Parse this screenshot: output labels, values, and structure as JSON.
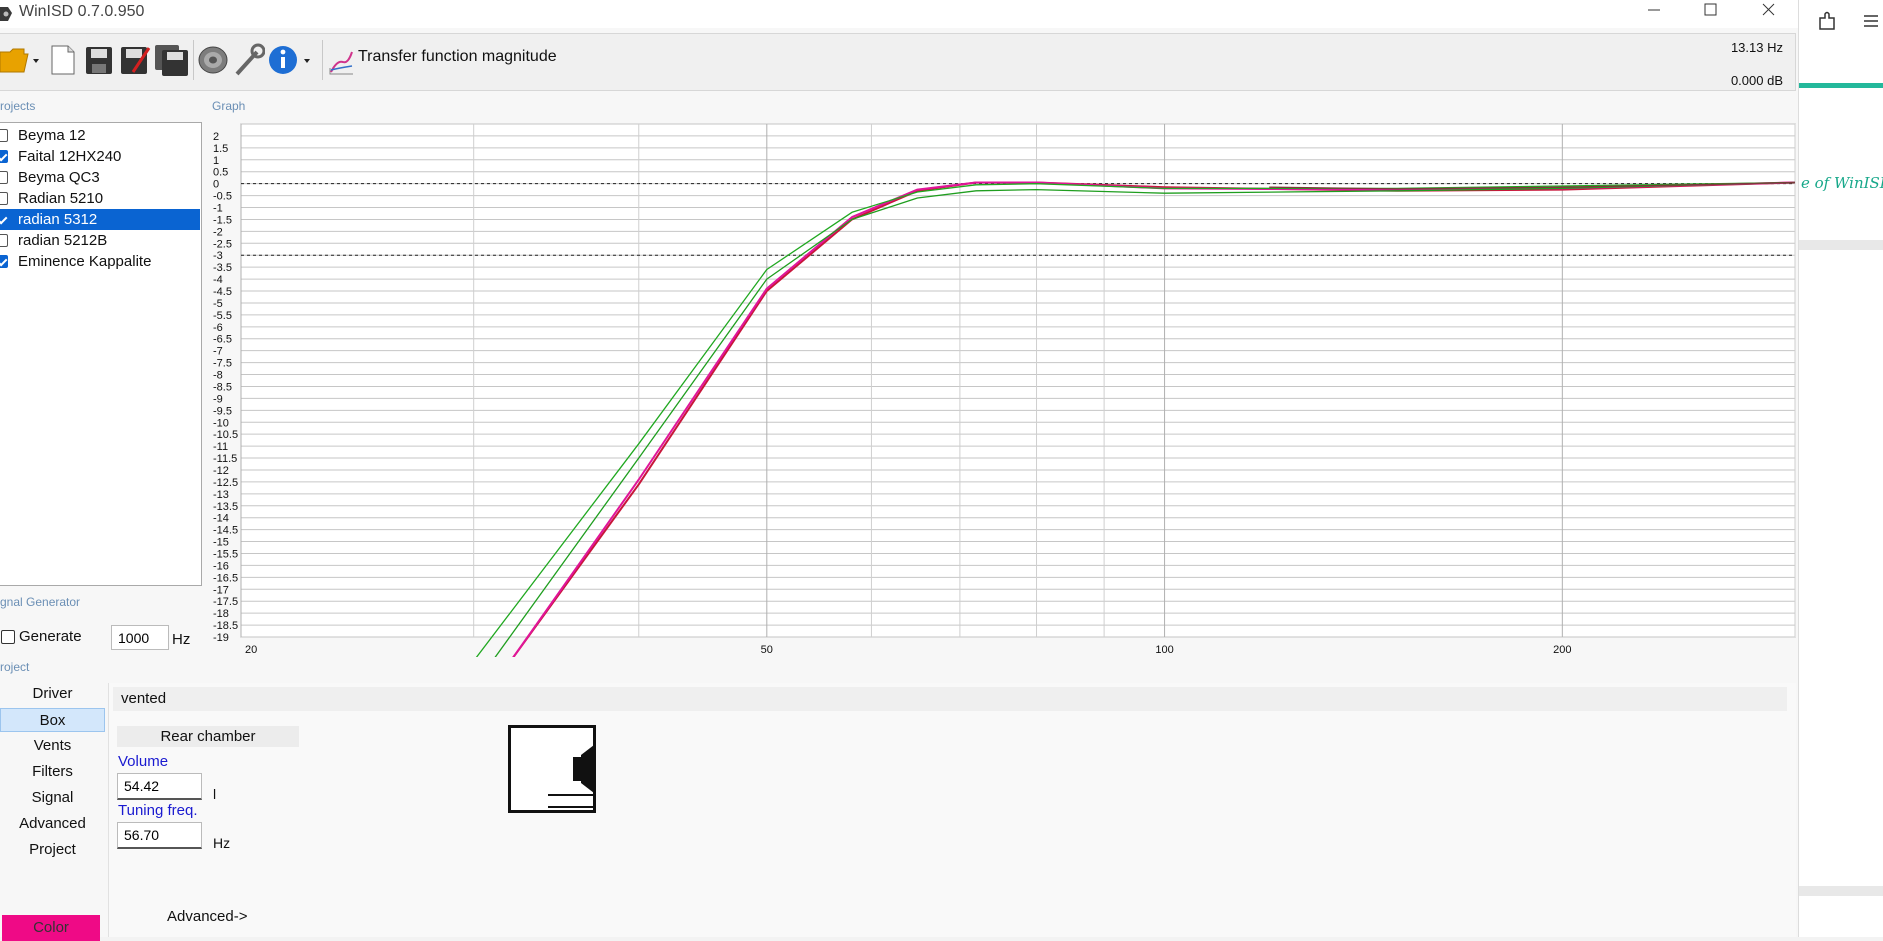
{
  "window": {
    "title": "WinISD 0.7.0.950"
  },
  "toolbar": {
    "graph_selector_label": "Transfer function magnitude"
  },
  "readout": {
    "frequency": "13.13 Hz",
    "level": "0.000 dB"
  },
  "sections": {
    "projects": "rojects",
    "graph": "Graph",
    "signal_generator": "gnal Generator",
    "project": "roject"
  },
  "projects": [
    {
      "name": "Beyma 12",
      "checked": false,
      "selected": false
    },
    {
      "name": "Faital 12HX240",
      "checked": true,
      "selected": false
    },
    {
      "name": "Beyma QC3",
      "checked": false,
      "selected": false
    },
    {
      "name": "Radian 5210",
      "checked": false,
      "selected": false
    },
    {
      "name": "radian 5312",
      "checked": true,
      "selected": true
    },
    {
      "name": "radian 5212B",
      "checked": false,
      "selected": false
    },
    {
      "name": "Eminence Kappalite",
      "checked": true,
      "selected": false
    }
  ],
  "signal_generator": {
    "generate_label": "Generate",
    "frequency": "1000",
    "unit": "Hz"
  },
  "nav": {
    "items": [
      "Driver",
      "Box",
      "Vents",
      "Filters",
      "Signal",
      "Advanced",
      "Project"
    ],
    "selected": "Box",
    "color_button": "Color"
  },
  "box_panel": {
    "box_type": "vented",
    "rear_chamber_label": "Rear chamber",
    "volume_label": "Volume",
    "volume_value": "54.42",
    "volume_unit": "l",
    "tuning_label": "Tuning freq.",
    "tuning_value": "56.70",
    "tuning_unit": "Hz",
    "advanced_link": "Advanced->"
  },
  "side_panel": {
    "brand_text": "e of WinISD"
  },
  "colors": {
    "selection": "#0a64d2",
    "section_label": "#6b8fb5",
    "field_label": "#1a1ad0",
    "color_swatch": "#ef0a86",
    "brand_teal": "#17a88a"
  },
  "chart_data": {
    "type": "line",
    "title": "",
    "xlabel": "",
    "ylabel": "",
    "x_scale": "log",
    "xlim": [
      20,
      300
    ],
    "ylim": [
      -19,
      2
    ],
    "x_ticks": [
      20,
      50,
      100,
      200
    ],
    "y_ticks": [
      "2",
      "1.5",
      "1",
      "0.5",
      "0",
      "-0.5",
      "-1",
      "-1.5",
      "-2",
      "-2.5",
      "-3",
      "-3.5",
      "-4",
      "-4.5",
      "-5",
      "-5.5",
      "-6",
      "-6.5",
      "-7",
      "-7.5",
      "-8",
      "-8.5",
      "-9",
      "-9.5",
      "-10",
      "-10.5",
      "-11",
      "-11.5",
      "-12",
      "-12.5",
      "-13",
      "-13.5",
      "-14",
      "-14.5",
      "-15",
      "-15.5",
      "-16",
      "-16.5",
      "-17",
      "-17.5",
      "-18",
      "-18.5",
      "-19"
    ],
    "reference_lines": [
      0,
      -3
    ],
    "grid": true,
    "series": [
      {
        "color": "#c8163a",
        "x": [
          32,
          40,
          50,
          58,
          65,
          72,
          80,
          100,
          150,
          200,
          300
        ],
        "y": [
          -20,
          -12.6,
          -4.5,
          -1.5,
          -0.3,
          0.05,
          0.05,
          -0.15,
          -0.3,
          -0.25,
          0.05
        ]
      },
      {
        "color": "#e0159a",
        "x": [
          32,
          40,
          50,
          58,
          65,
          72,
          80,
          100,
          150,
          200,
          300
        ],
        "y": [
          -20,
          -12.4,
          -4.4,
          -1.4,
          -0.25,
          0.05,
          0.05,
          -0.2,
          -0.25,
          -0.2,
          0.05
        ]
      },
      {
        "color": "#1f9e1f",
        "x": [
          31,
          40,
          50,
          58,
          65,
          72,
          80,
          100,
          150,
          200,
          300
        ],
        "y": [
          -20,
          -11.5,
          -4.0,
          -1.5,
          -0.6,
          -0.3,
          -0.25,
          -0.4,
          -0.3,
          -0.2,
          0.05
        ]
      },
      {
        "color": "#20a820",
        "x": [
          30,
          40,
          50,
          58,
          65,
          72,
          80,
          100,
          150,
          200,
          300
        ],
        "y": [
          -20,
          -10.9,
          -3.6,
          -1.2,
          -0.35,
          -0.05,
          0.0,
          -0.2,
          -0.2,
          -0.1,
          0.05
        ]
      },
      {
        "color": "#7a3a3a",
        "x": [
          120,
          150,
          200,
          250,
          300
        ],
        "y": [
          -0.15,
          -0.22,
          -0.15,
          -0.05,
          0.05
        ]
      }
    ]
  }
}
